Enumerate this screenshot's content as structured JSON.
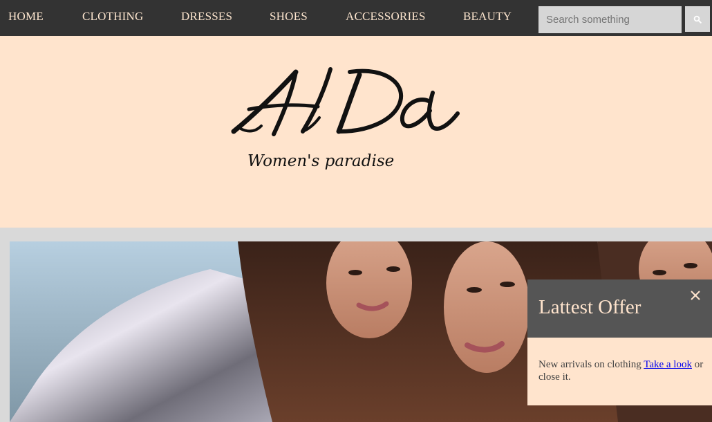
{
  "nav": {
    "items": [
      {
        "label": "HOME"
      },
      {
        "label": "CLOTHING"
      },
      {
        "label": "DRESSES"
      },
      {
        "label": "SHOES"
      },
      {
        "label": "ACCESSORIES"
      },
      {
        "label": "BEAUTY"
      }
    ],
    "search": {
      "placeholder": "Search something",
      "icon": "search-icon"
    }
  },
  "header": {
    "logo": {
      "title": "AlDa",
      "tagline": "Women's paradise"
    }
  },
  "offer": {
    "title": "Lattest Offer",
    "close_icon": "close-icon",
    "text_before": "New arrivals on clothing ",
    "link": "Take a look",
    "text_after": " or close it."
  },
  "colors": {
    "nav_bg": "#333333",
    "accent_peach": "#ffe4cd",
    "offer_head_bg": "#555555",
    "page_bg": "#d9d9d9",
    "link": "#0000ee"
  }
}
